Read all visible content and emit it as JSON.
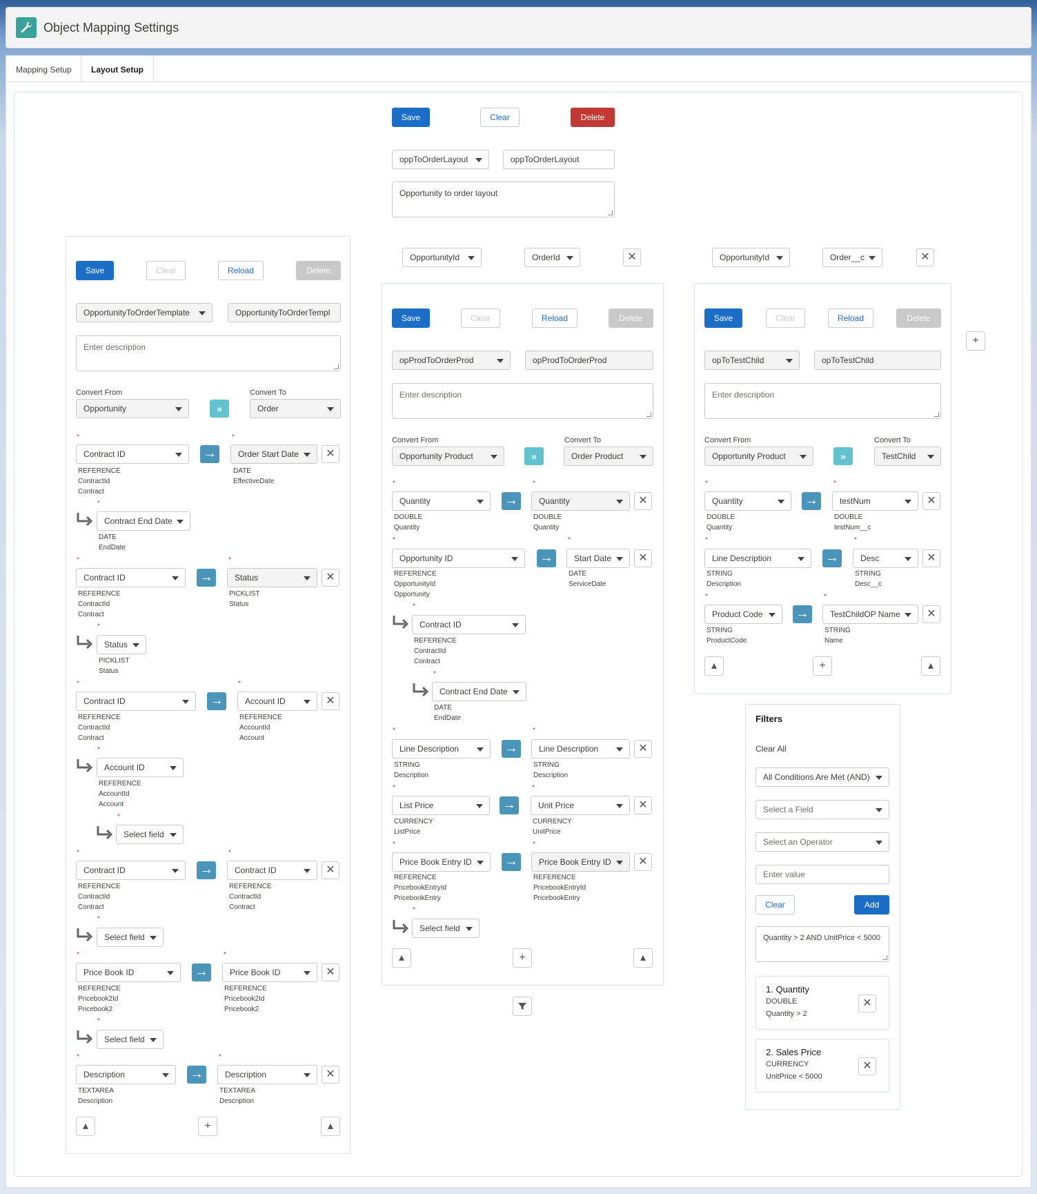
{
  "header": {
    "title": "Object Mapping Settings"
  },
  "tabs": {
    "mapping_setup": "Mapping Setup",
    "layout_setup": "Layout Setup"
  },
  "top": {
    "save": "Save",
    "clear": "Clear",
    "delete": "Delete",
    "layout_select": "oppToOrderLayout",
    "layout_name": "oppToOrderLayout",
    "description": "Opportunity to order layout"
  },
  "common": {
    "save": "Save",
    "clear": "Clear",
    "reload": "Reload",
    "delete": "Delete",
    "convert_from": "Convert From",
    "convert_to": "Convert To",
    "enter_description": "Enter description",
    "select_field": "Select field",
    "req": "*"
  },
  "left": {
    "template_select": "OpportunityToOrderTemplate",
    "template_name": "OpportunityToOrderTempl",
    "from": "Opportunity",
    "to": "Order",
    "rows": [
      {
        "src": "Contract ID",
        "src_meta": [
          "REFERENCE",
          "ContractId",
          "Contract"
        ],
        "dst": "Order Start Date",
        "dst_meta": [
          "DATE",
          "EffectiveDate"
        ],
        "child": {
          "label": "Contract End Date",
          "meta": [
            "DATE",
            "EndDate"
          ]
        }
      },
      {
        "src": "Contract ID",
        "src_meta": [
          "REFERENCE",
          "ContractId",
          "Contract"
        ],
        "dst": "Status",
        "dst_meta": [
          "PICKLIST",
          "Status"
        ],
        "child": {
          "label": "Status",
          "meta": [
            "PICKLIST",
            "Status"
          ]
        }
      },
      {
        "src": "Contract ID",
        "src_meta": [
          "REFERENCE",
          "ContractId",
          "Contract"
        ],
        "dst": "Account ID",
        "dst_meta": [
          "REFERENCE",
          "AccountId",
          "Account"
        ],
        "child": {
          "label": "Account ID",
          "meta": [
            "REFERENCE",
            "AccountId",
            "Account"
          ]
        },
        "grandchild": "Select field"
      },
      {
        "src": "Contract ID",
        "src_meta": [
          "REFERENCE",
          "ContractId",
          "Contract"
        ],
        "dst": "Contract ID",
        "dst_meta": [
          "REFERENCE",
          "ContractId",
          "Contract"
        ],
        "child_select": "Select field"
      },
      {
        "src": "Price Book ID",
        "src_meta": [
          "REFERENCE",
          "Pricebook2Id",
          "Pricebook2"
        ],
        "dst": "Price Book ID",
        "dst_meta": [
          "REFERENCE",
          "Pricebook2Id",
          "Pricebook2"
        ],
        "child_select": "Select field"
      },
      {
        "src": "Description",
        "src_meta": [
          "TEXTAREA",
          "Description"
        ],
        "dst": "Description",
        "dst_meta": [
          "TEXTAREA",
          "Description"
        ]
      }
    ]
  },
  "mid": {
    "pick_from": "OpportunityId",
    "pick_to": "OrderId",
    "template_select": "opProdToOrderProd",
    "template_name": "opProdToOrderProd",
    "from": "Opportunity Product",
    "to": "Order Product",
    "rows": [
      {
        "src": "Quantity",
        "src_meta": [
          "DOUBLE",
          "Quantity"
        ],
        "dst": "Quantity",
        "dst_meta": [
          "DOUBLE",
          "Quantity"
        ]
      },
      {
        "src": "Opportunity ID",
        "src_meta": [
          "REFERENCE",
          "OpportunityId",
          "Opportunity"
        ],
        "dst": "Start Date",
        "dst_meta": [
          "DATE",
          "ServiceDate"
        ],
        "child": {
          "label": "Contract ID",
          "meta": [
            "REFERENCE",
            "ContractId",
            "Contract"
          ]
        },
        "grandchild": {
          "label": "Contract End Date",
          "meta": [
            "DATE",
            "EndDate"
          ]
        }
      },
      {
        "src": "Line Description",
        "src_meta": [
          "STRING",
          "Description"
        ],
        "dst": "Line Description",
        "dst_meta": [
          "STRING",
          "Description"
        ]
      },
      {
        "src": "List Price",
        "src_meta": [
          "CURRENCY",
          "ListPrice"
        ],
        "dst": "Unit Price",
        "dst_meta": [
          "CURRENCY",
          "UnitPrice"
        ]
      },
      {
        "src": "Price Book Entry ID",
        "src_meta": [
          "REFERENCE",
          "PricebookEntryId",
          "PricebookEntry"
        ],
        "dst": "Price Book Entry ID",
        "dst_meta": [
          "REFERENCE",
          "PricebookEntryId",
          "PricebookEntry"
        ],
        "child_select": "Select field"
      }
    ]
  },
  "right": {
    "pick_from": "OpportunityId",
    "pick_to": "Order__c",
    "template_select": "opToTestChild",
    "template_name": "opToTestChild",
    "from": "Opportunity Product",
    "to": "TestChild",
    "rows": [
      {
        "src": "Quantity",
        "src_meta": [
          "DOUBLE",
          "Quantity"
        ],
        "dst": "testNum",
        "dst_meta": [
          "DOUBLE",
          "testNum__c"
        ]
      },
      {
        "src": "Line Description",
        "src_meta": [
          "STRING",
          "Description"
        ],
        "dst": "Desc",
        "dst_meta": [
          "STRING",
          "Desc__c"
        ]
      },
      {
        "src": "Product Code",
        "src_meta": [
          "STRING",
          "ProductCode"
        ],
        "dst": "TestChildOP Name",
        "dst_meta": [
          "STRING",
          "Name"
        ]
      }
    ]
  },
  "filters": {
    "title": "Filters",
    "clear_all": "Clear All",
    "logic": "All Conditions Are Met (AND)",
    "field_ph": "Select a Field",
    "operator_ph": "Select an Operator",
    "value_ph": "Enter value",
    "clear": "Clear",
    "add": "Add",
    "expression": "Quantity >  2  AND  UnitPrice < 5000",
    "items": [
      {
        "title": "1. Quantity",
        "type": "DOUBLE",
        "cond": "Quantity > 2"
      },
      {
        "title": "2. Sales Price",
        "type": "CURRENCY",
        "cond": "UnitPrice < 5000"
      }
    ]
  }
}
